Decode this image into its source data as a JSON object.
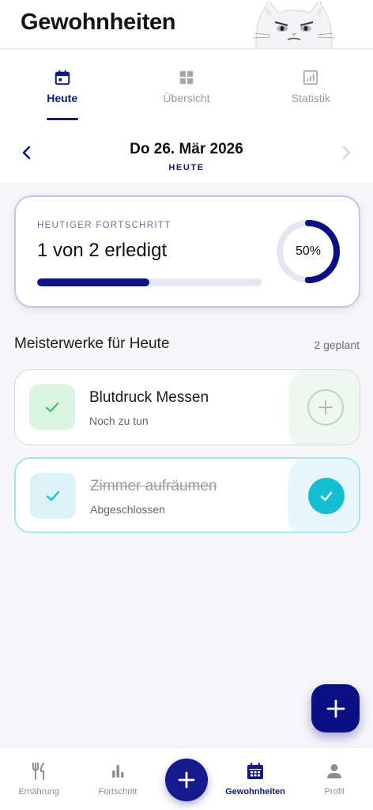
{
  "app": {
    "title": "Gewohnheiten"
  },
  "tabs": [
    {
      "label": "Heute",
      "icon": "calendar-icon",
      "active": true
    },
    {
      "label": "Übersicht",
      "icon": "grid-icon",
      "active": false
    },
    {
      "label": "Statistik",
      "icon": "chart-icon",
      "active": false
    }
  ],
  "date_nav": {
    "date": "Do 26. Mär 2026",
    "sub": "HEUTE"
  },
  "progress": {
    "label": "HEUTIGER FORTSCHRITT",
    "value_text": "1 von 2 erledigt",
    "percent_text": "50%",
    "fraction": 0.5
  },
  "section": {
    "title": "Meisterwerke für Heute",
    "count": "2 geplant"
  },
  "habits": [
    {
      "name": "Blutdruck Messen",
      "status": "Noch zu tun",
      "done": false
    },
    {
      "name": "Zimmer aufräumen",
      "status": "Abgeschlossen",
      "done": true
    }
  ],
  "bottom_nav": [
    {
      "label": "Ernährung",
      "icon": "fork-knife-icon",
      "active": false
    },
    {
      "label": "Fortschritt",
      "icon": "bar-chart-icon",
      "active": false
    },
    {
      "label": "Gewohnheiten",
      "icon": "calendar-grid-icon",
      "active": true
    },
    {
      "label": "Profil",
      "icon": "person-icon",
      "active": false
    }
  ],
  "colors": {
    "primary": "#0f1a7a",
    "accent_teal": "#13bfd0",
    "success_green": "#2ecc71"
  }
}
